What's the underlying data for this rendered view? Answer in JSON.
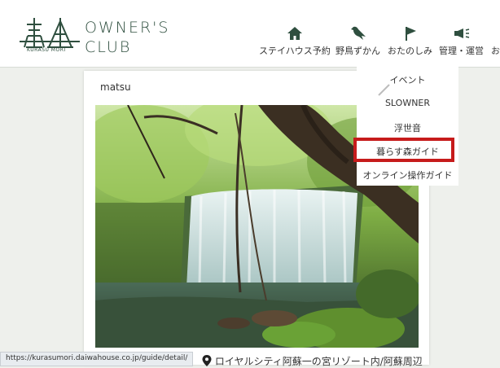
{
  "header": {
    "logo_sub": "KURASU MORI",
    "brand_line1": "OWNER'S",
    "brand_line2": "CLUB",
    "logo_icon": "forest-gate-icon",
    "nav": [
      {
        "label": "ステイハウス予約",
        "icon": "house-icon"
      },
      {
        "label": "野鳥ずかん",
        "icon": "bird-icon"
      },
      {
        "label": "おたのしみ",
        "icon": "flag-icon"
      },
      {
        "label": "管理・運営",
        "icon": "megaphone-icon"
      },
      {
        "label": "お"
      }
    ]
  },
  "dropdown": {
    "items": [
      "イベント",
      "SLOWNER",
      "浮世音",
      "暮らす森ガイド",
      "オンライン操作ガイド"
    ],
    "highlighted": "暮らす森ガイド"
  },
  "post": {
    "user": "matsu",
    "location": "ロイヤルシティ阿蘇一の宮リゾート内/阿蘇周辺",
    "location_icon": "map-pin-icon"
  },
  "status_bar": {
    "url": "https://kurasumori.daiwahouse.co.jp/guide/detail/"
  },
  "colors": {
    "brand": "#2f4f3f",
    "highlight": "#c61b1b",
    "background": "#eef0ec"
  }
}
